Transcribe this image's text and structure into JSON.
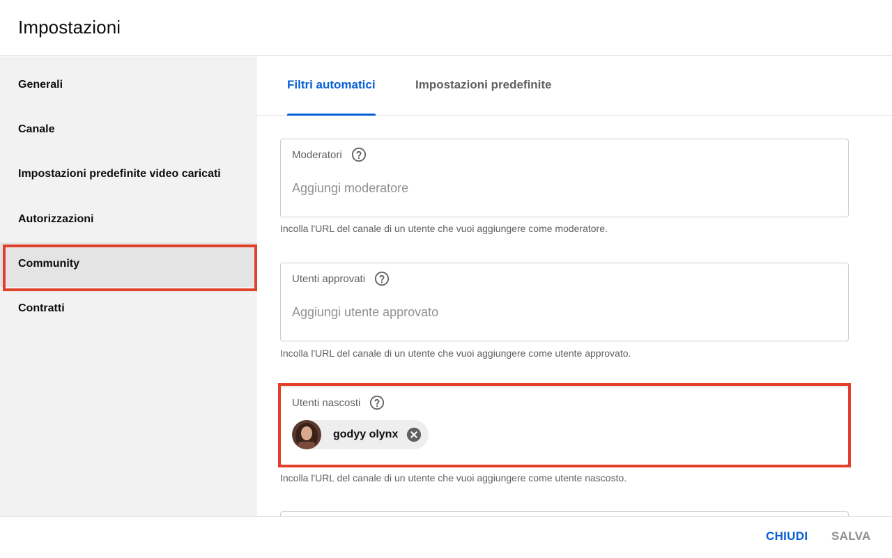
{
  "header": {
    "title": "Impostazioni"
  },
  "sidebar": {
    "items": [
      {
        "label": "Generali"
      },
      {
        "label": "Canale"
      },
      {
        "label": "Impostazioni predefinite video caricati"
      },
      {
        "label": "Autorizzazioni"
      },
      {
        "label": "Community",
        "selected": true
      },
      {
        "label": "Contratti"
      }
    ]
  },
  "tabs": [
    {
      "label": "Filtri automatici",
      "active": true
    },
    {
      "label": "Impostazioni predefinite",
      "active": false
    }
  ],
  "fields": {
    "moderators": {
      "label": "Moderatori",
      "placeholder": "Aggiungi moderatore",
      "value": "",
      "hint": "Incolla l'URL del canale di un utente che vuoi aggiungere come moderatore."
    },
    "approved": {
      "label": "Utenti approvati",
      "placeholder": "Aggiungi utente approvato",
      "value": "",
      "hint": "Incolla l'URL del canale di un utente che vuoi aggiungere come utente approvato."
    },
    "hidden": {
      "label": "Utenti nascosti",
      "chips": [
        {
          "name": "godyy olynx"
        }
      ],
      "hint": "Incolla l'URL del canale di un utente che vuoi aggiungere come utente nascosto."
    }
  },
  "footer": {
    "close_label": "CHIUDI",
    "save_label": "SALVA"
  },
  "icons": {
    "help": "help-circle-icon",
    "remove": "close-circle-icon",
    "avatar": "user-avatar"
  },
  "colors": {
    "accent": "#065fd4",
    "highlight": "#e2402b",
    "disabled": "#909090",
    "sidebar_bg": "#f2f2f2",
    "sidebar_selected": "#e4e4e4"
  }
}
